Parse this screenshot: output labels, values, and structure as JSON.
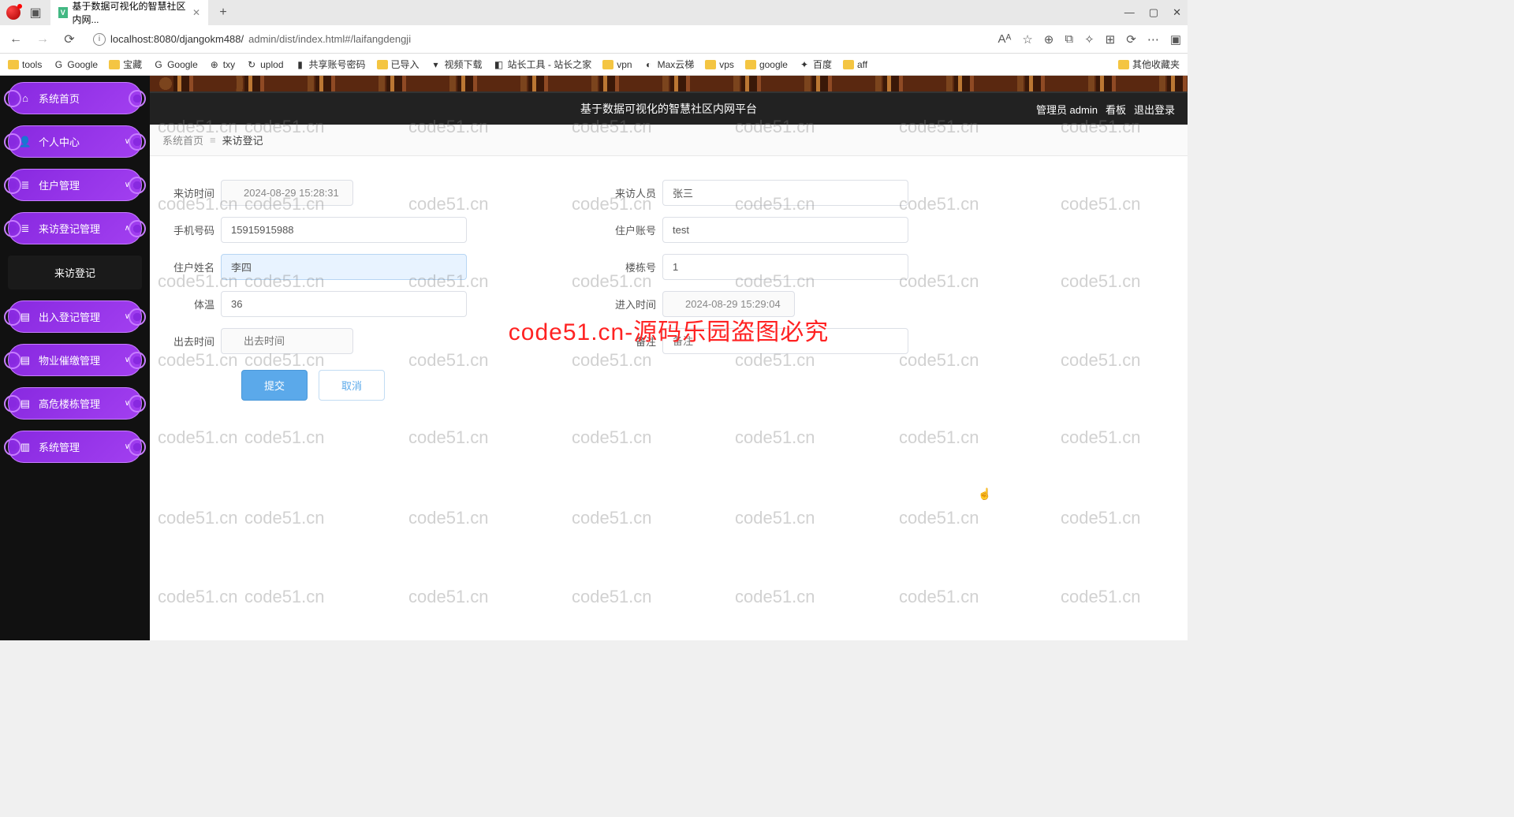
{
  "browser": {
    "tab_title": "基于数据可视化的智慧社区内网...",
    "url_display": "admin/dist/index.html#/laifangdengji",
    "url_host": "localhost:8080/djangokm488/",
    "new_tab_tooltip": "+",
    "window": {
      "min": "—",
      "max": "▢",
      "close": "✕"
    },
    "nav": {
      "back": "←",
      "forward": "→",
      "refresh": "⟳"
    },
    "right_icons": [
      "Aᴬ",
      "☆",
      "⊕",
      "⧉",
      "✧",
      "⊞",
      "⟳",
      "⋯",
      "▣"
    ],
    "bookmarks": [
      {
        "type": "folder",
        "label": "tools"
      },
      {
        "type": "link",
        "label": "Google",
        "favicon": "G"
      },
      {
        "type": "folder",
        "label": "宝藏"
      },
      {
        "type": "link",
        "label": "Google",
        "favicon": "G"
      },
      {
        "type": "link",
        "label": "txy",
        "favicon": "⊕"
      },
      {
        "type": "link",
        "label": "uplod",
        "favicon": "↻"
      },
      {
        "type": "link",
        "label": "共享账号密码",
        "favicon": "▮"
      },
      {
        "type": "folder",
        "label": "已导入"
      },
      {
        "type": "link",
        "label": "视频下载",
        "favicon": "▾"
      },
      {
        "type": "link",
        "label": "站长工具 - 站长之家",
        "favicon": "◧"
      },
      {
        "type": "folder",
        "label": "vpn"
      },
      {
        "type": "link",
        "label": "Max云梯",
        "favicon": "◐"
      },
      {
        "type": "folder",
        "label": "vps"
      },
      {
        "type": "folder",
        "label": "google"
      },
      {
        "type": "link",
        "label": "百度",
        "favicon": "✦"
      },
      {
        "type": "folder",
        "label": "aff"
      }
    ],
    "bookmarks_more": "其他收藏夹"
  },
  "header": {
    "title": "基于数据可视化的智慧社区内网平台",
    "admin": "管理员 admin",
    "board": "看板",
    "logout": "退出登录"
  },
  "sidebar": {
    "items": [
      {
        "icon": "⌂",
        "label": "系统首页",
        "expandable": false
      },
      {
        "icon": "👤",
        "label": "个人中心",
        "expandable": true
      },
      {
        "icon": "≣",
        "label": "住户管理",
        "expandable": true
      },
      {
        "icon": "≣",
        "label": "来访登记管理",
        "expandable": true,
        "expanded": true,
        "sub": "来访登记"
      },
      {
        "icon": "▤",
        "label": "出入登记管理",
        "expandable": true
      },
      {
        "icon": "▤",
        "label": "物业催缴管理",
        "expandable": true
      },
      {
        "icon": "▤",
        "label": "高危楼栋管理",
        "expandable": true
      },
      {
        "icon": "▥",
        "label": "系统管理",
        "expandable": true
      }
    ]
  },
  "breadcrumb": {
    "home": "系统首页",
    "current": "来访登记"
  },
  "form": {
    "visit_time": {
      "label": "来访时间",
      "value": "2024-08-29 15:28:31"
    },
    "visitor": {
      "label": "来访人员",
      "value": "张三"
    },
    "phone": {
      "label": "手机号码",
      "value": "15915915988"
    },
    "account": {
      "label": "住户账号",
      "value": "test"
    },
    "resident": {
      "label": "住户姓名",
      "value": "李四"
    },
    "building": {
      "label": "楼栋号",
      "value": "1"
    },
    "temp": {
      "label": "体温",
      "value": "36"
    },
    "enter_time": {
      "label": "进入时间",
      "value": "2024-08-29 15:29:04"
    },
    "leave_time": {
      "label": "出去时间",
      "placeholder": "出去时间",
      "value": ""
    },
    "remark": {
      "label": "备注",
      "placeholder": "备注",
      "value": ""
    },
    "submit": "提交",
    "cancel": "取消"
  },
  "watermark": {
    "small": "code51.cn",
    "main": "code51.cn-源码乐园盗图必究"
  }
}
